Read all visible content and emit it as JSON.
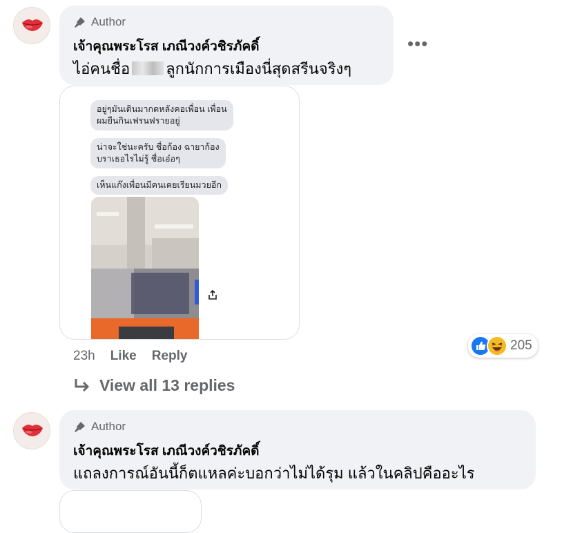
{
  "comments": [
    {
      "author_badge": "Author",
      "name": "เจ้าคุณพระโรส เภณีวงค์วชิรภัคดิ์",
      "text_before": "ไอ่คนชื่อ",
      "text_after": "ลูกนักการเมืองนี่สุดสรีนจริงๆ",
      "more": "•••",
      "attachment_messages": [
        {
          "line1": "อยู่ๆมันเดินมากดหลังคอเพื่อน เพื่อน",
          "line2": "ผมยืนกินเฟรนฟรายอยู่"
        },
        {
          "line1": "น่าจะใช่นะครับ ชื่อก้อง ฉายาก้อง",
          "line2": "บราเธอไรไม่รู้ ชื่อเอ๋อๆ"
        },
        {
          "line1": "เห็นแก๊งเพื่อนมีคนเคยเรียนมวยอีก",
          "line2": ""
        }
      ],
      "time": "23h",
      "like_label": "Like",
      "reply_label": "Reply",
      "reactions": [
        "like-icon",
        "laugh-icon"
      ],
      "reaction_count": "205",
      "view_replies": "View all 13 replies"
    },
    {
      "author_badge": "Author",
      "name": "เจ้าคุณพระโรส เภณีวงค์วชิรภัคดิ์",
      "text": "แถลงการณ์อันนี้ก็ตแหลค่ะบอกว่าไม่ได้รุม แล้วในคลิปคืออะไร"
    }
  ],
  "colors": {
    "bubble": "#f0f2f5",
    "secondary_text": "#65676b",
    "like_blue": "#1877f2",
    "laugh_yellow": "#f7b928"
  }
}
